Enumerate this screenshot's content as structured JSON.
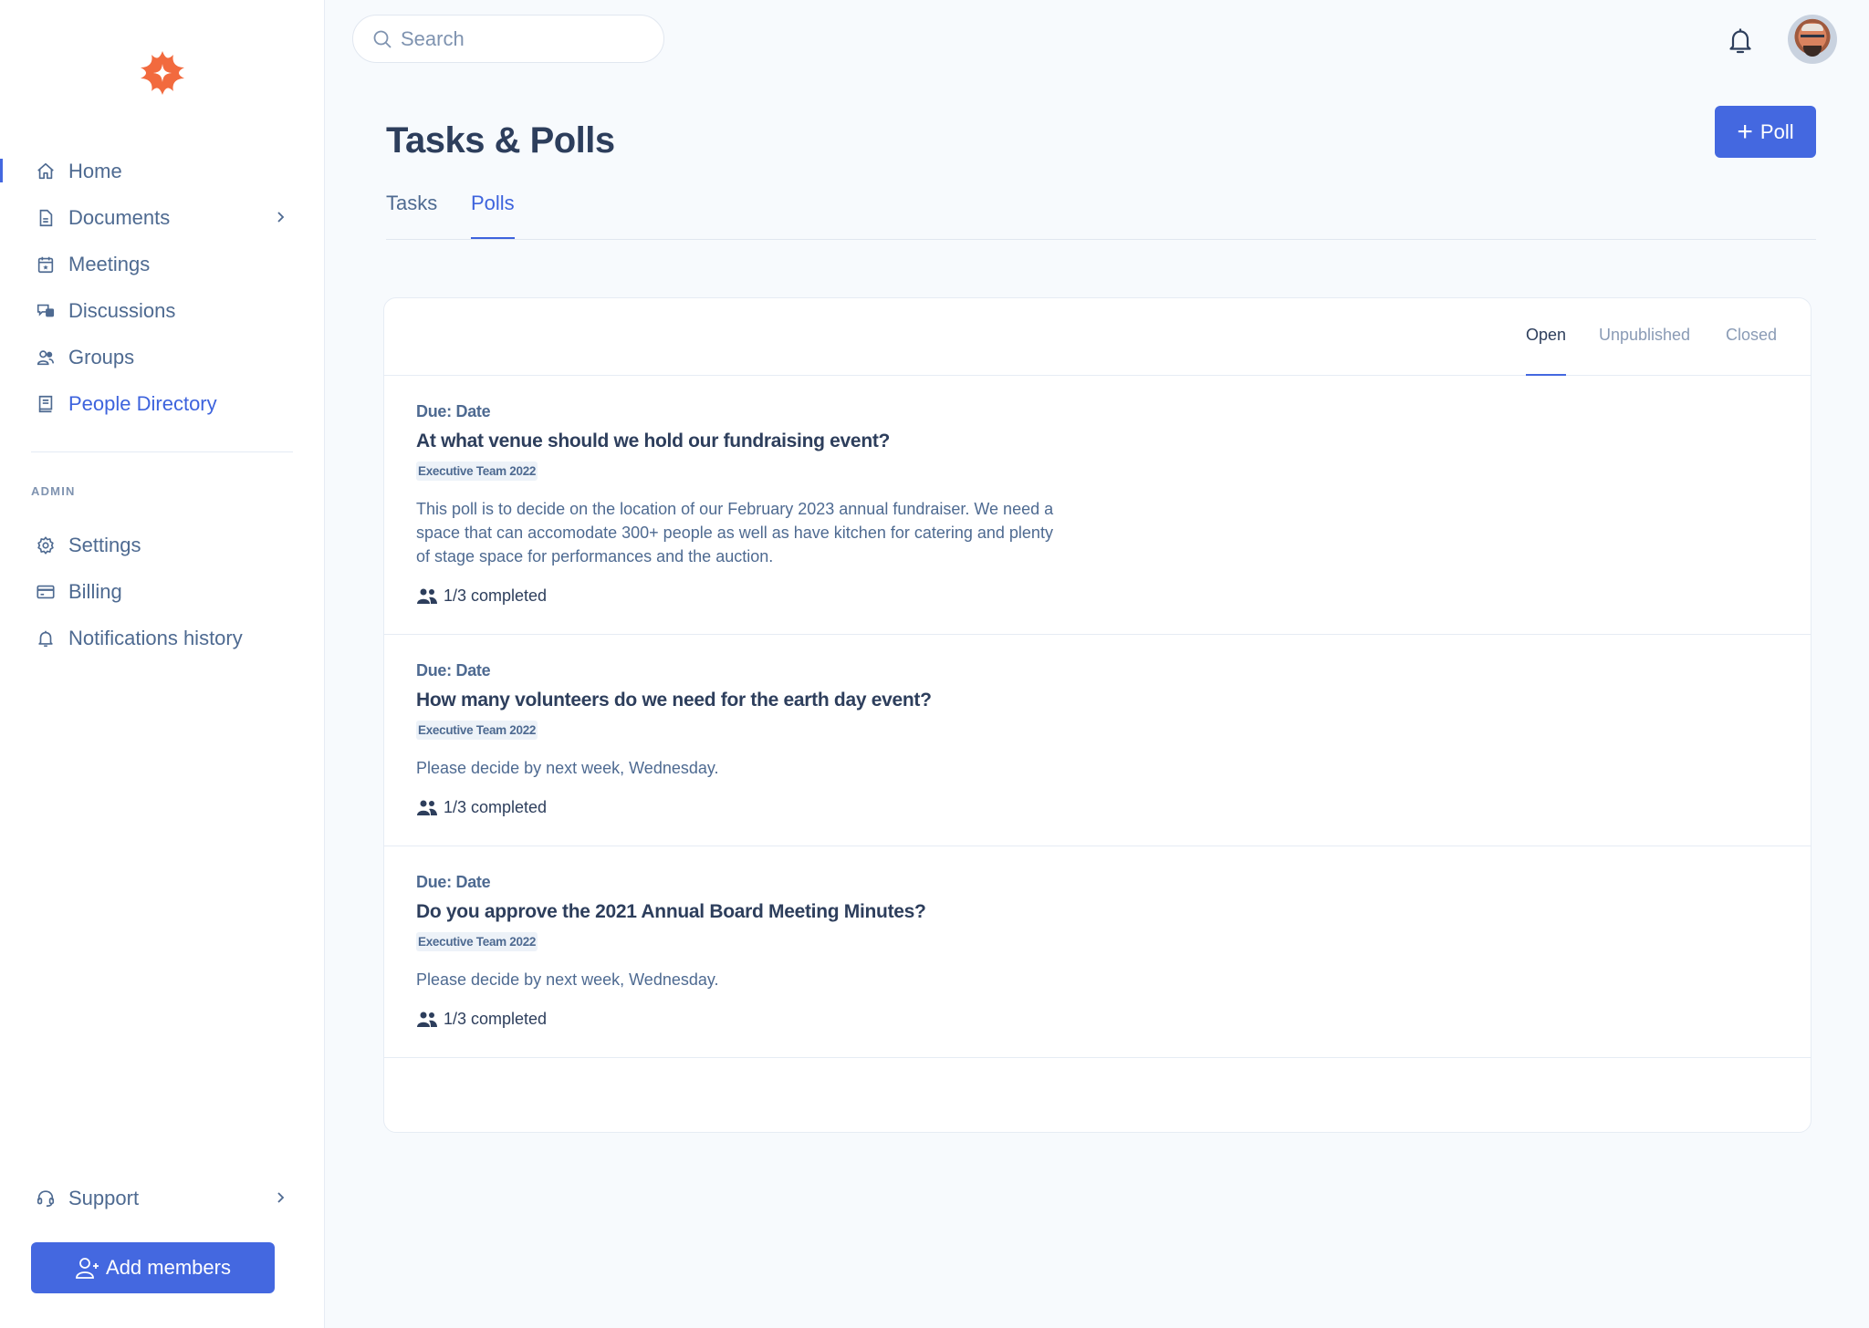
{
  "brand": {
    "logo_icon": "sparkle-logo",
    "color": "#f26a3e"
  },
  "accent": "#4468e0",
  "sidebar": {
    "items": [
      {
        "label": "Home",
        "icon": "home-icon"
      },
      {
        "label": "Documents",
        "icon": "document-icon",
        "has_submenu": true
      },
      {
        "label": "Meetings",
        "icon": "calendar-icon"
      },
      {
        "label": "Discussions",
        "icon": "chat-icon"
      },
      {
        "label": "Groups",
        "icon": "users-icon"
      },
      {
        "label": "People Directory",
        "icon": "book-icon"
      }
    ],
    "admin_label": "ADMIN",
    "admin_items": [
      {
        "label": "Settings",
        "icon": "gear-icon"
      },
      {
        "label": "Billing",
        "icon": "credit-card-icon"
      },
      {
        "label": "Notifications history",
        "icon": "bell-icon"
      }
    ],
    "support": {
      "label": "Support",
      "icon": "headset-icon"
    },
    "add_members_label": "Add members"
  },
  "header": {
    "search_placeholder": "Search",
    "search_value": ""
  },
  "page": {
    "title": "Tasks & Polls",
    "new_poll_label": "Poll",
    "tabs": [
      {
        "label": "Tasks",
        "active": false
      },
      {
        "label": "Polls",
        "active": true
      }
    ]
  },
  "filters": [
    {
      "label": "Open",
      "active": true
    },
    {
      "label": "Unpublished",
      "active": false
    },
    {
      "label": "Closed",
      "active": false
    }
  ],
  "polls": [
    {
      "due": "Due: Date",
      "question": "At what venue should we hold our fundraising event?",
      "group": "Executive Team 2022",
      "description": "This poll is to decide on the location of our February 2023 annual fundraiser. We need a space that can accomodate 300+ people as well as have kitchen for catering and plenty of stage space for performances and the auction.",
      "progress": "1/3 completed"
    },
    {
      "due": "Due: Date",
      "question": "How many volunteers do we need for the earth day event?",
      "group": "Executive Team 2022",
      "description": "Please decide by next week, Wednesday.",
      "progress": "1/3 completed"
    },
    {
      "due": "Due: Date",
      "question": "Do you approve the 2021 Annual Board Meeting Minutes?",
      "group": "Executive Team 2022",
      "description": "Please decide by next week, Wednesday.",
      "progress": "1/3 completed"
    }
  ]
}
